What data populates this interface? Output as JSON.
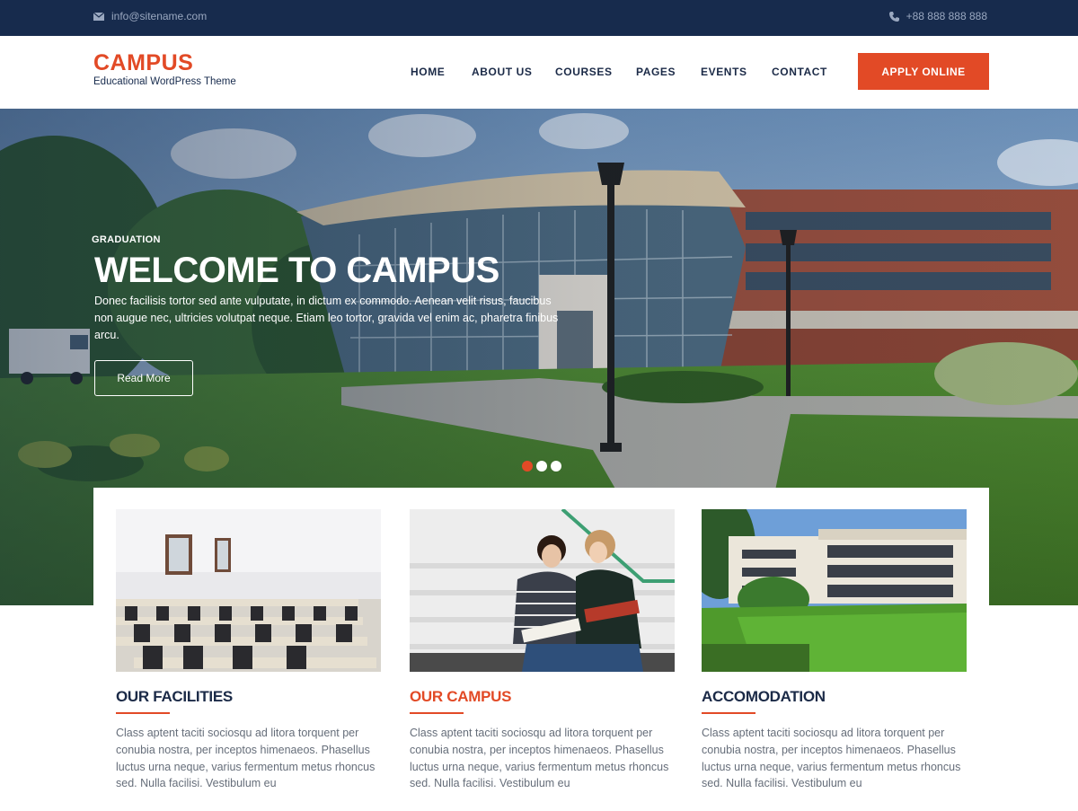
{
  "topbar": {
    "email": "info@sitename.com",
    "phone": "+88 888 888 888",
    "email_icon": "envelope-icon",
    "phone_icon": "phone-icon"
  },
  "logo": {
    "brand": "CAMPUS",
    "tagline": "Educational WordPress Theme"
  },
  "nav": {
    "items": [
      "HOME",
      "ABOUT US",
      "COURSES",
      "PAGES",
      "EVENTS",
      "CONTACT"
    ],
    "apply_label": "APPLY ONLINE"
  },
  "hero": {
    "eyebrow": "GRADUATION",
    "title": "WELCOME TO CAMPUS",
    "text": "Donec facilisis tortor sed ante vulputate, in dictum ex commodo. Aenean velit risus, faucibus non augue nec, ultricies volutpat neque. Etiam leo tortor, gravida vel enim ac, pharetra finibus arcu.",
    "button_label": "Read More",
    "slides": 3,
    "active_slide": 1
  },
  "cards": [
    {
      "title": "OUR FACILITIES",
      "text": "Class aptent taciti sociosqu ad litora torquent per conubia nostra, per inceptos himenaeos. Phasellus luctus urna neque, varius fermentum metus rhoncus sed. Nulla facilisi. Vestibulum eu",
      "highlight": false
    },
    {
      "title": "OUR CAMPUS",
      "text": "Class aptent taciti sociosqu ad litora torquent per conubia nostra, per inceptos himenaeos. Phasellus luctus urna neque, varius fermentum metus rhoncus sed. Nulla facilisi. Vestibulum eu",
      "highlight": true
    },
    {
      "title": "ACCOMODATION",
      "text": "Class aptent taciti sociosqu ad litora torquent per conubia nostra, per inceptos himenaeos. Phasellus luctus urna neque, varius fermentum metus rhoncus sed. Nulla facilisi. Vestibulum eu",
      "highlight": false
    }
  ],
  "colors": {
    "accent": "#e24a26",
    "navy": "#172b4d",
    "text": "#1b2a47"
  }
}
